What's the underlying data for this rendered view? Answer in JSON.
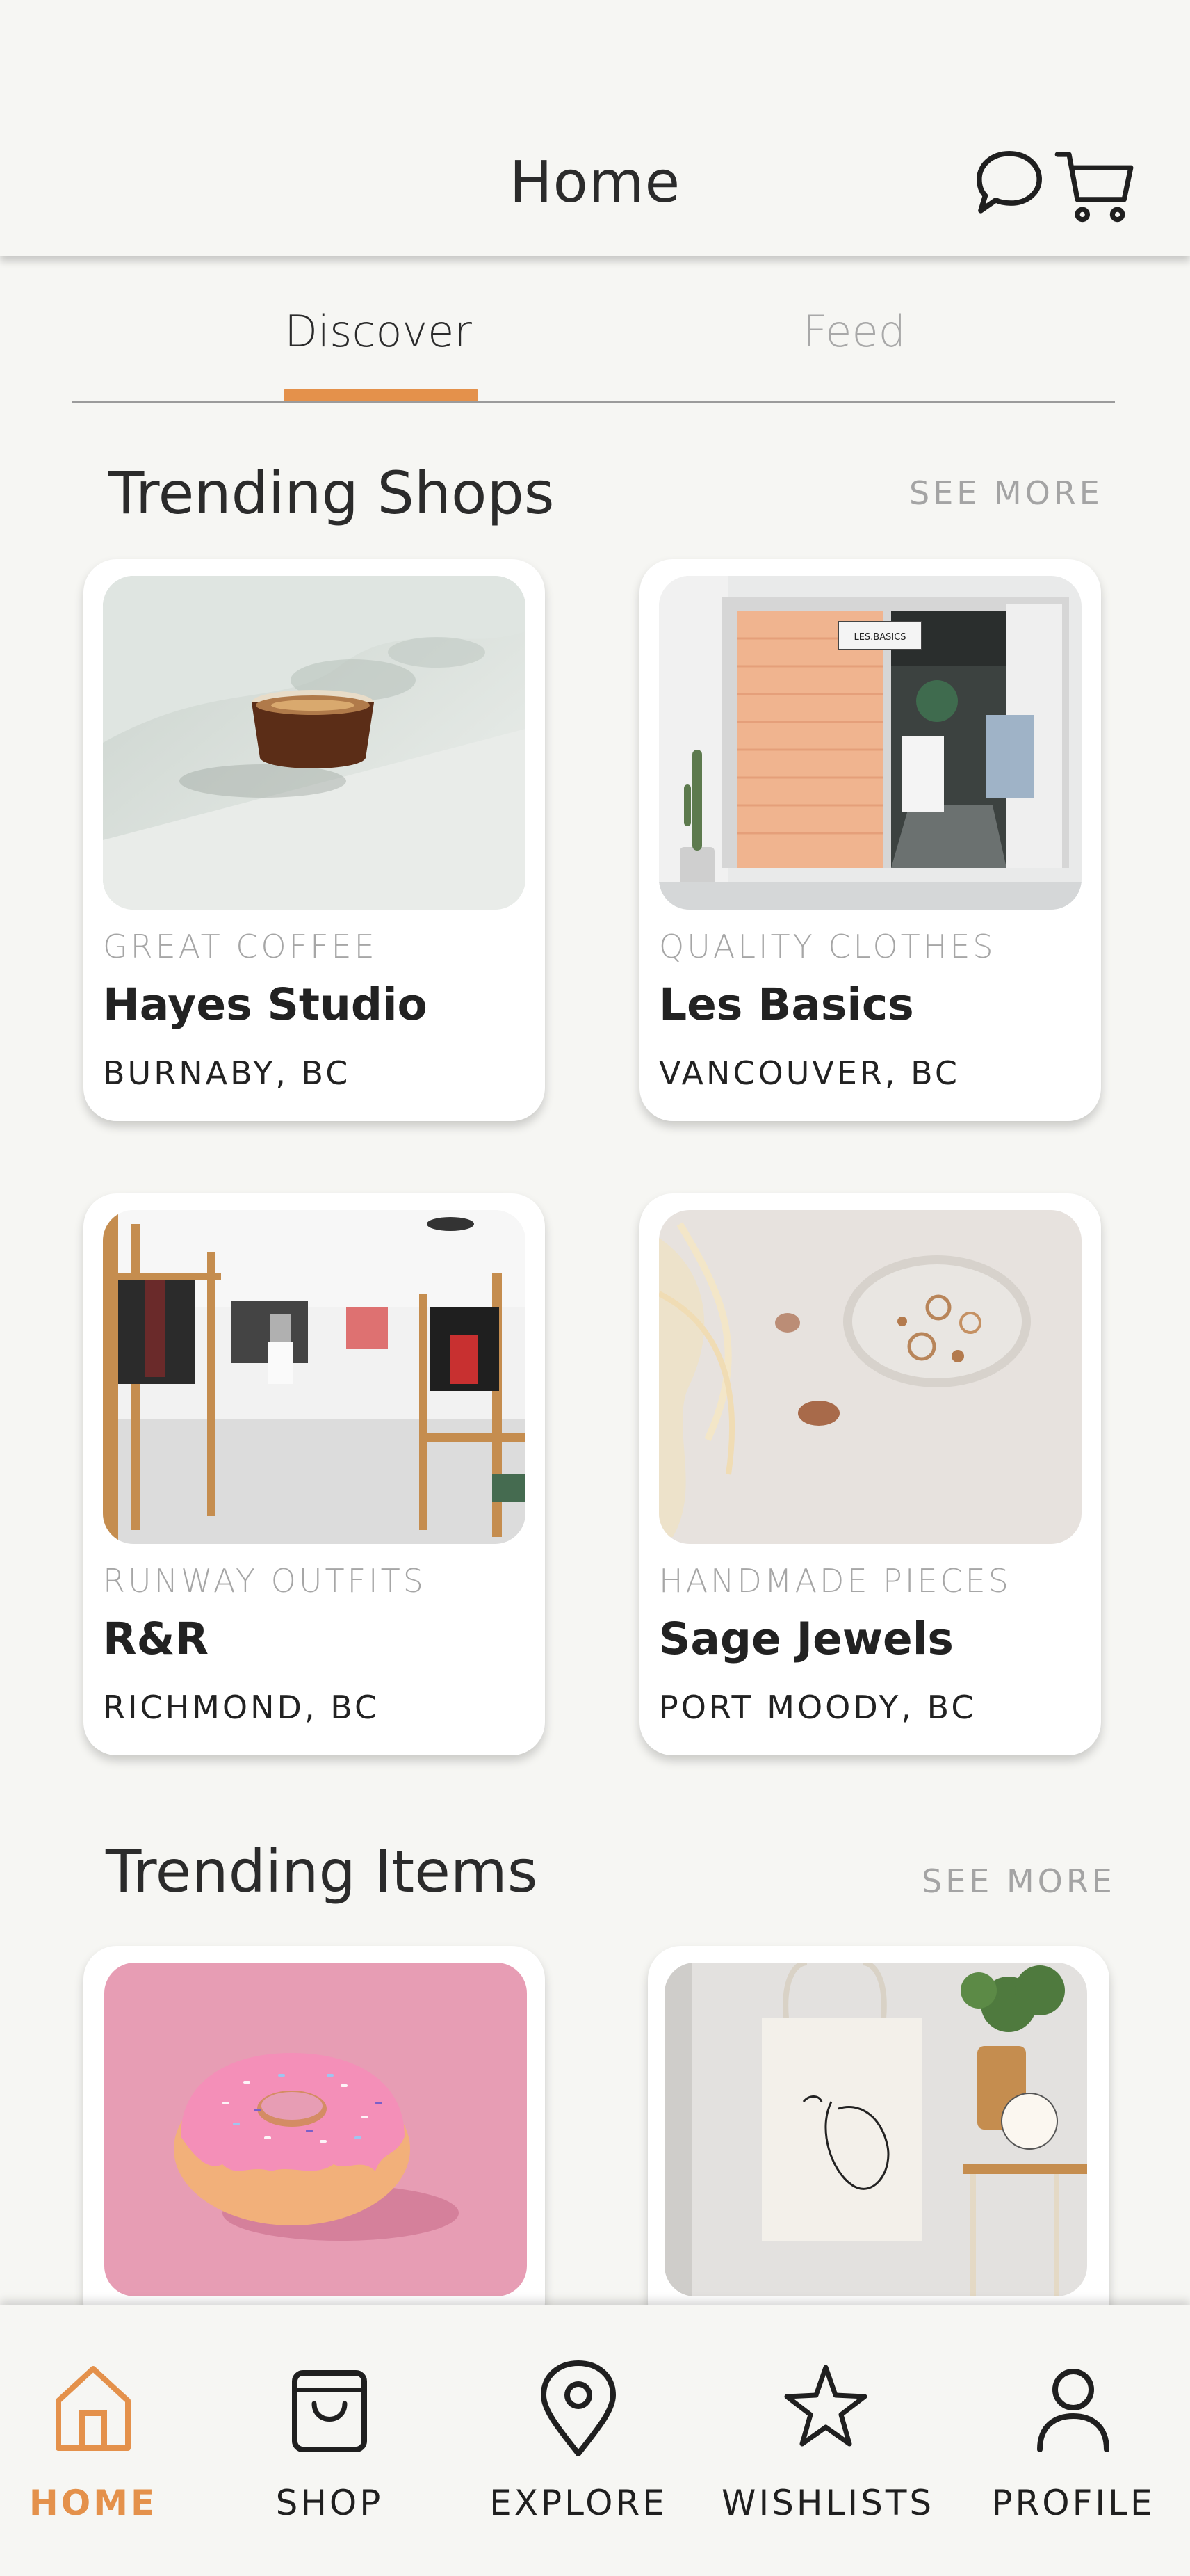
{
  "header": {
    "title": "Home"
  },
  "tabs": [
    {
      "label": "Discover"
    },
    {
      "label": "Feed"
    }
  ],
  "trending_shops": {
    "title": "Trending Shops",
    "see_more": "SEE MORE",
    "shops": [
      {
        "category": "GREAT COFFEE",
        "name": "Hayes  Studio",
        "location": "BURNABY, BC"
      },
      {
        "category": "QUALITY CLOTHES",
        "name": "Les Basics",
        "location": "VANCOUVER, BC"
      },
      {
        "category": "RUNWAY OUTFITS",
        "name": "R&R",
        "location": "RICHMOND, BC"
      },
      {
        "category": "HANDMADE PIECES",
        "name": "Sage Jewels",
        "location": "PORT MOODY, BC"
      }
    ]
  },
  "trending_items": {
    "title": "Trending Items",
    "see_more": "SEE MORE"
  },
  "store_sign": "LES.BASICS",
  "bottom_nav": [
    {
      "label": "HOME",
      "icon": "home-icon",
      "active": true
    },
    {
      "label": "SHOP",
      "icon": "shopping-bag-icon"
    },
    {
      "label": "EXPLORE",
      "icon": "map-pin-icon"
    },
    {
      "label": "WISHLISTS",
      "icon": "star-icon"
    },
    {
      "label": "PROFILE",
      "icon": "user-icon"
    }
  ],
  "colors": {
    "accent": "#e4914b",
    "background": "#f6f6f3",
    "muted_text": "#a6a6a6"
  }
}
